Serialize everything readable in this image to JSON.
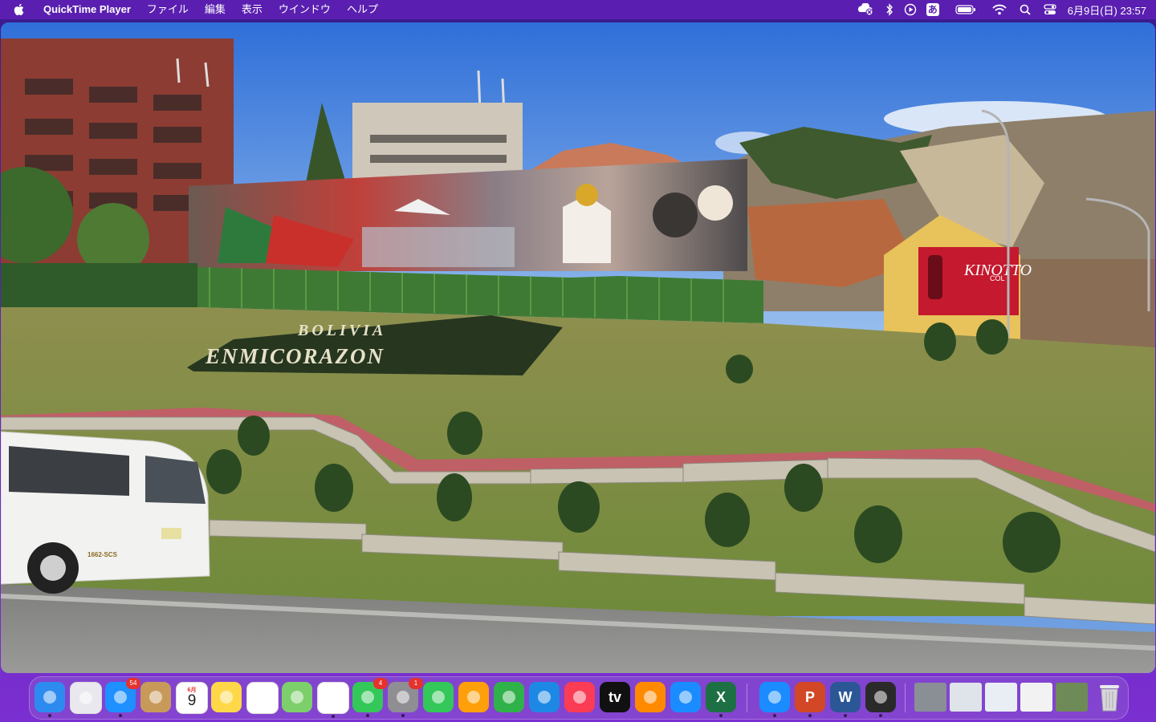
{
  "menubar": {
    "app_name": "QuickTime Player",
    "items": [
      "ファイル",
      "編集",
      "表示",
      "ウインドウ",
      "ヘルプ"
    ],
    "clock": "6月9日(日) 23:57",
    "input_method": "あ",
    "status_icons": [
      "screen-sharing-icon",
      "bluetooth-icon",
      "play-circle-icon",
      "input-method-icon",
      "battery-icon",
      "wifi-icon",
      "search-icon",
      "control-center-icon"
    ]
  },
  "video": {
    "sign_line1": "BOLIVIA",
    "sign_line2": "ENMICORAZON",
    "billboard": "KINOTTO",
    "billboard_sub": "COL",
    "van_plate": "1662-SCS"
  },
  "dock": {
    "apps": [
      {
        "name": "Finder",
        "icon": "finder-icon",
        "color": "#2d8bf0"
      },
      {
        "name": "Launchpad",
        "icon": "launchpad-icon",
        "color": "#e8e8ee"
      },
      {
        "name": "Mail",
        "icon": "mail-icon",
        "color": "#1e90ff",
        "badge": "54"
      },
      {
        "name": "Contacts",
        "icon": "contacts-icon",
        "color": "#c89a5a"
      },
      {
        "name": "Calendar",
        "icon": "calendar-icon",
        "color": "#ffffff",
        "month": "6月",
        "day": "9"
      },
      {
        "name": "Notes",
        "icon": "notes-icon",
        "color": "#ffd84a"
      },
      {
        "name": "Reminders",
        "icon": "reminders-icon",
        "color": "#ffffff"
      },
      {
        "name": "Maps",
        "icon": "maps-icon",
        "color": "#7ccf6a"
      },
      {
        "name": "Photos",
        "icon": "photos-icon",
        "color": "#ffffff"
      },
      {
        "name": "Messages",
        "icon": "messages-icon",
        "color": "#34c759",
        "badge": "4"
      },
      {
        "name": "System Settings",
        "icon": "settings-icon",
        "color": "#8e8e93",
        "badge": "1"
      },
      {
        "name": "FaceTime",
        "icon": "facetime-icon",
        "color": "#34c759"
      },
      {
        "name": "Pages",
        "icon": "pages-icon",
        "color": "#ff9f0a"
      },
      {
        "name": "Numbers",
        "icon": "numbers-icon",
        "color": "#30b24a"
      },
      {
        "name": "Keynote",
        "icon": "keynote-icon",
        "color": "#1e88e5"
      },
      {
        "name": "Music",
        "icon": "music-icon",
        "color": "#fa3c55"
      },
      {
        "name": "TV",
        "icon": "tv-icon",
        "color": "#111111",
        "label": "tv"
      },
      {
        "name": "Books",
        "icon": "books-icon",
        "color": "#ff8a00"
      },
      {
        "name": "App Store",
        "icon": "app-store-icon",
        "color": "#1a8cff"
      },
      {
        "name": "Excel",
        "icon": "excel-icon",
        "color": "#1d7044",
        "label": "X"
      },
      {
        "name": "Safari",
        "icon": "safari-icon",
        "color": "#1a8cff"
      },
      {
        "name": "PowerPoint",
        "icon": "powerpoint-icon",
        "color": "#d24726",
        "label": "P"
      },
      {
        "name": "Word",
        "icon": "word-icon",
        "color": "#2b5797",
        "label": "W"
      },
      {
        "name": "QuickTime Player",
        "icon": "quicktime-icon",
        "color": "#2a2a2a"
      }
    ],
    "trash": {
      "name": "Trash",
      "icon": "trash-icon"
    }
  },
  "colors": {
    "menubar": "#5a1fb0",
    "accent": "#7b2fd0"
  }
}
